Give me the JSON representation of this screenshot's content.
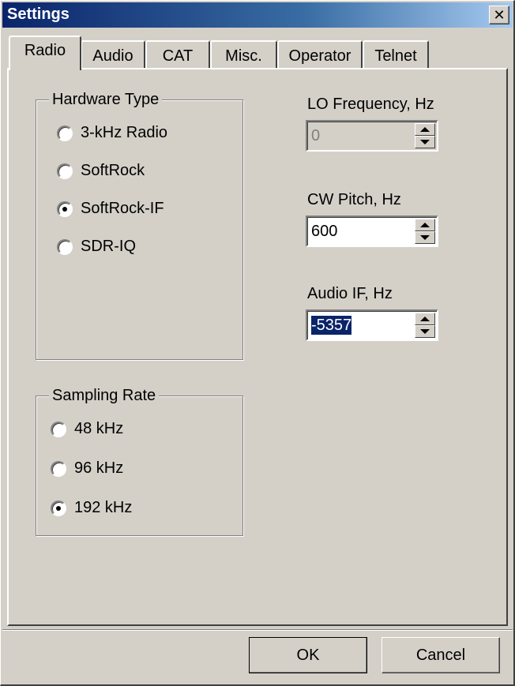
{
  "window": {
    "title": "Settings"
  },
  "tabs": [
    {
      "label": "Radio",
      "active": true
    },
    {
      "label": "Audio"
    },
    {
      "label": "CAT"
    },
    {
      "label": "Misc."
    },
    {
      "label": "Operator"
    },
    {
      "label": "Telnet"
    }
  ],
  "hardware_type": {
    "title": "Hardware Type",
    "options": [
      {
        "label": "3-kHz Radio",
        "checked": false
      },
      {
        "label": "SoftRock",
        "checked": false
      },
      {
        "label": "SoftRock-IF",
        "checked": true
      },
      {
        "label": "SDR-IQ",
        "checked": false
      }
    ]
  },
  "sampling_rate": {
    "title": "Sampling Rate",
    "options": [
      {
        "label": "48 kHz",
        "checked": false
      },
      {
        "label": "96 kHz",
        "checked": false
      },
      {
        "label": "192 kHz",
        "checked": true
      }
    ]
  },
  "lo_frequency": {
    "label": "LO Frequency, Hz",
    "value": "0",
    "disabled": true
  },
  "cw_pitch": {
    "label": "CW Pitch, Hz",
    "value": "600"
  },
  "audio_if": {
    "label": "Audio IF, Hz",
    "value": "-5357",
    "selected": true
  },
  "buttons": {
    "ok": "OK",
    "cancel": "Cancel"
  }
}
